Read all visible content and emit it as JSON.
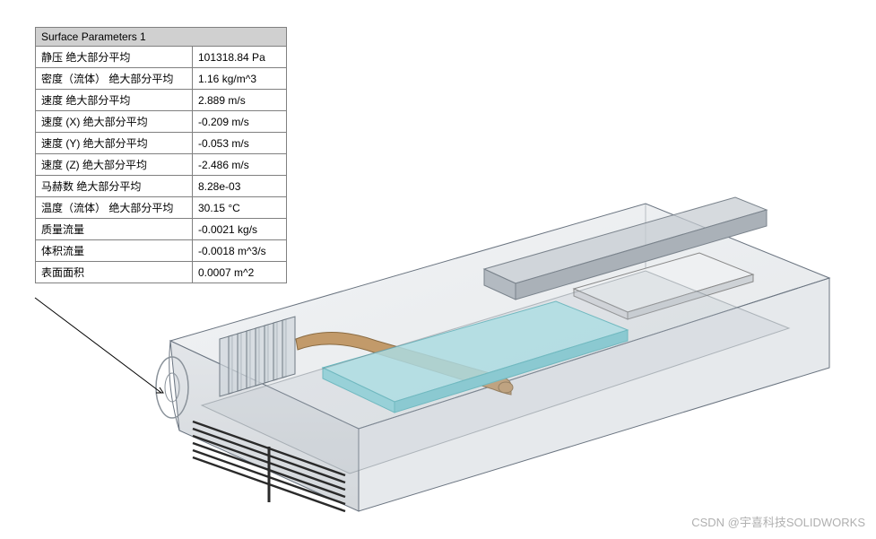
{
  "callout": {
    "title": "Surface Parameters 1",
    "rows": [
      {
        "label": "静压 绝大部分平均",
        "value": "101318.84 Pa"
      },
      {
        "label": "密度（流体） 绝大部分平均",
        "value": "1.16 kg/m^3"
      },
      {
        "label": "速度 绝大部分平均",
        "value": "2.889 m/s"
      },
      {
        "label": "速度 (X) 绝大部分平均",
        "value": "-0.209 m/s"
      },
      {
        "label": "速度 (Y) 绝大部分平均",
        "value": "-0.053 m/s"
      },
      {
        "label": "速度 (Z) 绝大部分平均",
        "value": "-2.486 m/s"
      },
      {
        "label": "马赫数 绝大部分平均",
        "value": "8.28e-03"
      },
      {
        "label": "温度（流体） 绝大部分平均",
        "value": "30.15 °C"
      },
      {
        "label": "质量流量",
        "value": "-0.0021 kg/s"
      },
      {
        "label": "体积流量",
        "value": "-0.0018 m^3/s"
      },
      {
        "label": "表面面积",
        "value": "0.0007 m^2"
      }
    ]
  },
  "watermark": "CSDN @宇喜科技SOLIDWORKS"
}
